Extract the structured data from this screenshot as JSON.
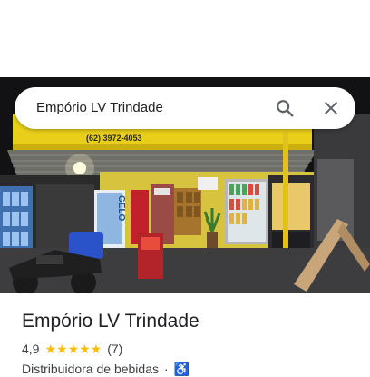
{
  "search": {
    "query": "Empório LV Trindade",
    "search_icon": "search-icon",
    "close_icon": "close-icon"
  },
  "photo": {
    "sign_phone": "(62) 3972-4053",
    "cooler_label": "GELO"
  },
  "place": {
    "name": "Empório LV Trindade",
    "rating": "4,9",
    "stars": "★★★★★",
    "review_count": "(7)",
    "category": "Distribuidora de bebidas",
    "separator": "·",
    "accessibility_icon": "wheelchair-icon"
  },
  "colors": {
    "star": "#fbbc04",
    "accessibility": "#1a73e8"
  }
}
